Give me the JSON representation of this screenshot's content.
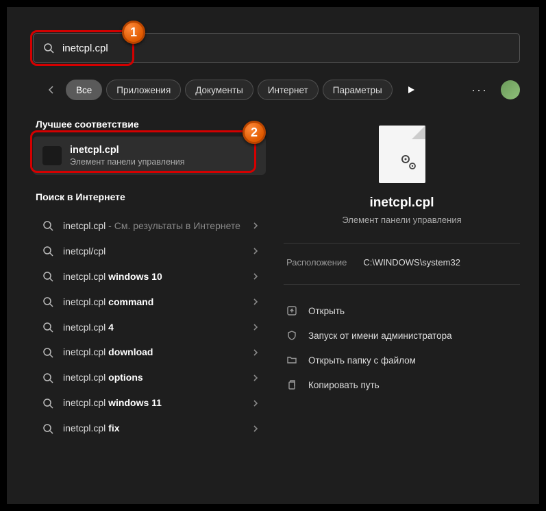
{
  "search": {
    "value": "inetcpl.cpl"
  },
  "tabs": {
    "all": "Все",
    "apps": "Приложения",
    "docs": "Документы",
    "internet": "Интернет",
    "params": "Параметры"
  },
  "sections": {
    "best": "Лучшее соответствие",
    "web": "Поиск в Интернете"
  },
  "best": {
    "title": "inetcpl.cpl",
    "subtitle": "Элемент панели управления"
  },
  "web": [
    {
      "pre": "inetcpl.cpl",
      "dim": " - См. результаты в Интернете",
      "bold": ""
    },
    {
      "pre": "inetcpl/cpl",
      "dim": "",
      "bold": ""
    },
    {
      "pre": "inetcpl.cpl ",
      "dim": "",
      "bold": "windows 10"
    },
    {
      "pre": "inetcpl.cpl ",
      "dim": "",
      "bold": "command"
    },
    {
      "pre": "inetcpl.cpl ",
      "dim": "",
      "bold": "4"
    },
    {
      "pre": "inetcpl.cpl ",
      "dim": "",
      "bold": "download"
    },
    {
      "pre": "inetcpl.cpl ",
      "dim": "",
      "bold": "options"
    },
    {
      "pre": "inetcpl.cpl ",
      "dim": "",
      "bold": "windows 11"
    },
    {
      "pre": "inetcpl.cpl ",
      "dim": "",
      "bold": "fix"
    }
  ],
  "detail": {
    "title": "inetcpl.cpl",
    "subtitle": "Элемент панели управления",
    "loc_label": "Расположение",
    "loc_value": "C:\\WINDOWS\\system32"
  },
  "actions": {
    "open": "Открыть",
    "admin": "Запуск от имени администратора",
    "folder": "Открыть папку с файлом",
    "copy": "Копировать путь"
  },
  "badges": {
    "1": "1",
    "2": "2"
  }
}
